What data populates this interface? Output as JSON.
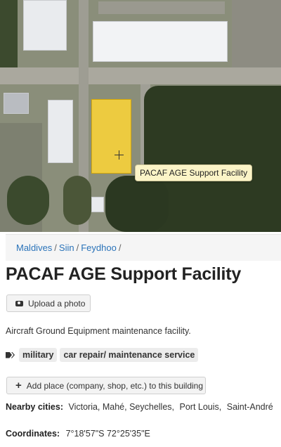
{
  "map": {
    "tooltip": "PACAF AGE Support Facility"
  },
  "breadcrumb": {
    "items": [
      "Maldives",
      "Siin",
      "Feydhoo"
    ],
    "separator": "/"
  },
  "title": "PACAF AGE Support Facility",
  "upload_button": {
    "label": "Upload a photo",
    "icon": "camera-icon"
  },
  "description": "Aircraft Ground Equipment maintenance facility.",
  "tags": {
    "icon": "tags-icon",
    "items": [
      "military",
      "car repair/ maintenance service"
    ]
  },
  "add_place_button": {
    "label": "Add place (company, shop, etc.) to this building",
    "icon": "plus-icon"
  },
  "nearby": {
    "label": "Nearby cities:",
    "cities": [
      "Victoria, Mahé, Seychelles",
      "Port Louis",
      "Saint-André"
    ]
  },
  "coordinates": {
    "label": "Coordinates:",
    "value": "7°18'57\"S 72°25'35\"E"
  }
}
